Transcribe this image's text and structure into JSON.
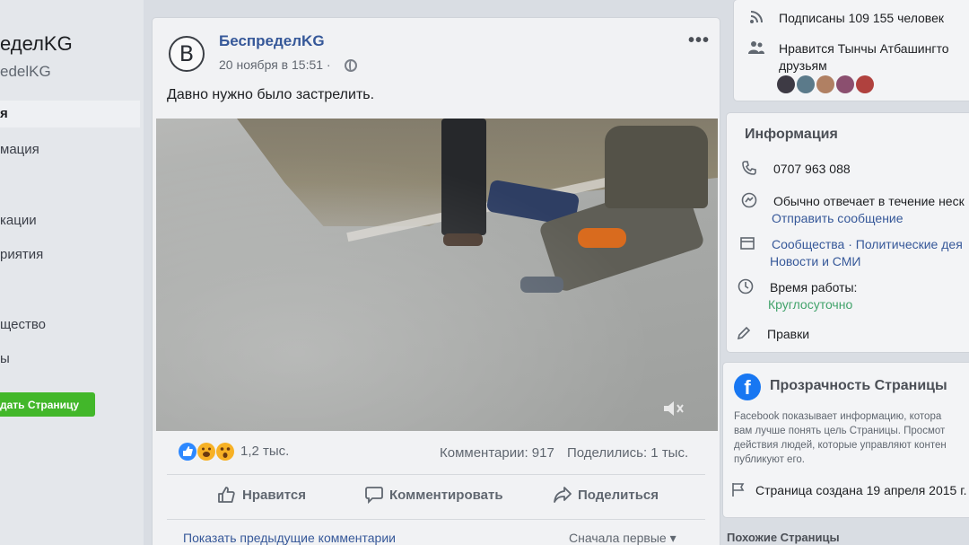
{
  "left_sidebar": {
    "page_name": "еделKG",
    "page_handle": "edelKG",
    "nav_items": [
      "я",
      "мация",
      "кации",
      "риятия",
      "щество",
      "ы"
    ],
    "create_page_label": "дать Страницу"
  },
  "post": {
    "avatar_letter": "B",
    "author": "БеспределKG",
    "date": "20 ноября в 15:51 ·",
    "more_label": "•••",
    "text": "Давно нужно было застрелить.",
    "reactions_count": "1,2 тыс.",
    "comments": "Комментарии: 917",
    "shares": "Поделились: 1 тыс.",
    "actions": {
      "like": "Нравится",
      "comment": "Комментировать",
      "share": "Поделиться"
    },
    "prev_comments": "Показать предыдущие комментарии",
    "sort_label": "Сначала первые ▾"
  },
  "right_column": {
    "followers": "Подписаны 109 155 человек",
    "liked_by": "Нравится Тынчы Атбашингто",
    "liked_by_line2": "друзьям",
    "info": {
      "title": "Информация",
      "phone": "0707 963 088",
      "response": "Обычно отвечает в течение неск",
      "send_message": "Отправить сообщение",
      "categories_line1": "Сообщества · Политические дея",
      "categories_line2": "Новости и СМИ",
      "hours_label": "Время работы:",
      "hours_value": "Круглосуточно",
      "edits": "Правки"
    },
    "transparency": {
      "title": "Прозрачность Страницы",
      "text_lines": [
        "Facebook показывает информацию, котора",
        "вам лучше понять цель Страницы. Просмот",
        "действия людей, которые управляют контен",
        "публикуют его."
      ],
      "created": "Страница создана 19 апреля 2015 г."
    },
    "similar_pages": "Похожие Страницы"
  },
  "colors": {
    "link_blue": "#365899",
    "create_green": "#42b72a",
    "facebook_blue": "#1877f2",
    "like_blue": "#2d88ff"
  },
  "icons": [
    "globe-icon",
    "more-icon",
    "volume-icon",
    "like-icon",
    "comment-icon",
    "share-icon",
    "rss-icon",
    "friends-icon",
    "phone-icon",
    "messenger-icon",
    "flag-icon",
    "clock-icon",
    "pencil-icon",
    "facebook-icon"
  ]
}
